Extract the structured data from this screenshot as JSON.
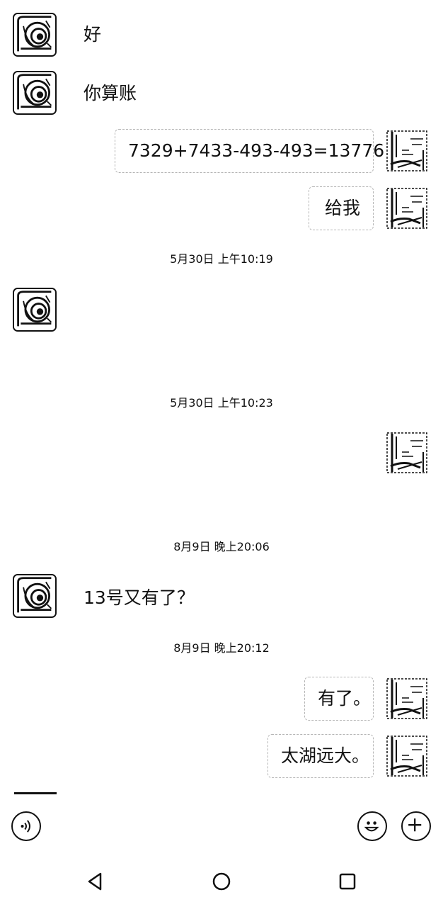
{
  "messages": [
    {
      "side": "left",
      "text": "好"
    },
    {
      "side": "left",
      "text": "你算账"
    },
    {
      "side": "right",
      "text": "7329+7433-493-493=13776"
    },
    {
      "side": "right",
      "text": "给我"
    },
    {
      "type": "timestamp",
      "text": "5月30日 上午10:19"
    },
    {
      "side": "left",
      "text": ""
    },
    {
      "type": "timestamp",
      "text": "5月30日 上午10:23"
    },
    {
      "side": "right",
      "text": ""
    },
    {
      "type": "timestamp",
      "text": "8月9日 晚上20:06"
    },
    {
      "side": "left",
      "text": "13号又有了？"
    },
    {
      "type": "timestamp",
      "text": "8月9日 晚上20:12"
    },
    {
      "side": "right",
      "text": "有了。"
    },
    {
      "side": "right",
      "text": "太湖远大。"
    }
  ],
  "input_bar": {
    "voice_icon": "voice-icon",
    "emoji_icon": "emoji-icon",
    "add_icon": "plus-icon"
  },
  "nav_bar": {
    "back_icon": "back-triangle-icon",
    "home_icon": "home-circle-icon",
    "recents_icon": "recents-square-icon"
  }
}
